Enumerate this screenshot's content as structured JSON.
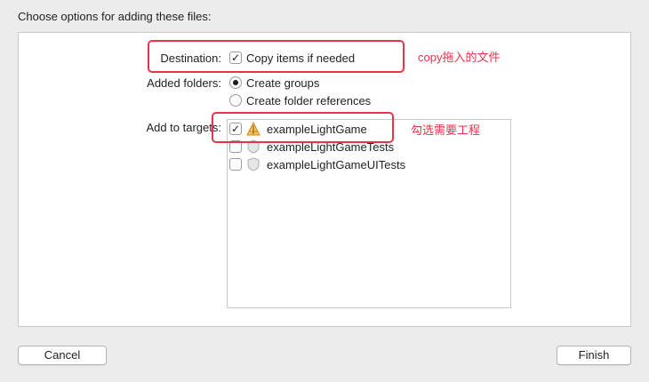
{
  "dialog": {
    "title": "Choose options for adding these files:"
  },
  "destination": {
    "label": "Destination:",
    "option_label": "Copy items if needed",
    "checked": true
  },
  "added_folders": {
    "label": "Added folders:",
    "options": [
      {
        "label": "Create groups",
        "selected": true
      },
      {
        "label": "Create folder references",
        "selected": false
      }
    ]
  },
  "targets": {
    "label": "Add to targets:",
    "items": [
      {
        "name": "exampleLightGame",
        "checked": true,
        "icon": "app-icon"
      },
      {
        "name": "exampleLightGameTests",
        "checked": false,
        "icon": "test-bundle-icon"
      },
      {
        "name": "exampleLightGameUITests",
        "checked": false,
        "icon": "test-bundle-icon"
      }
    ]
  },
  "annotations": {
    "copy_note": "copy拖入的文件",
    "target_note": "勾选需要工程",
    "color": "#e8344a"
  },
  "buttons": {
    "cancel": "Cancel",
    "finish": "Finish"
  }
}
